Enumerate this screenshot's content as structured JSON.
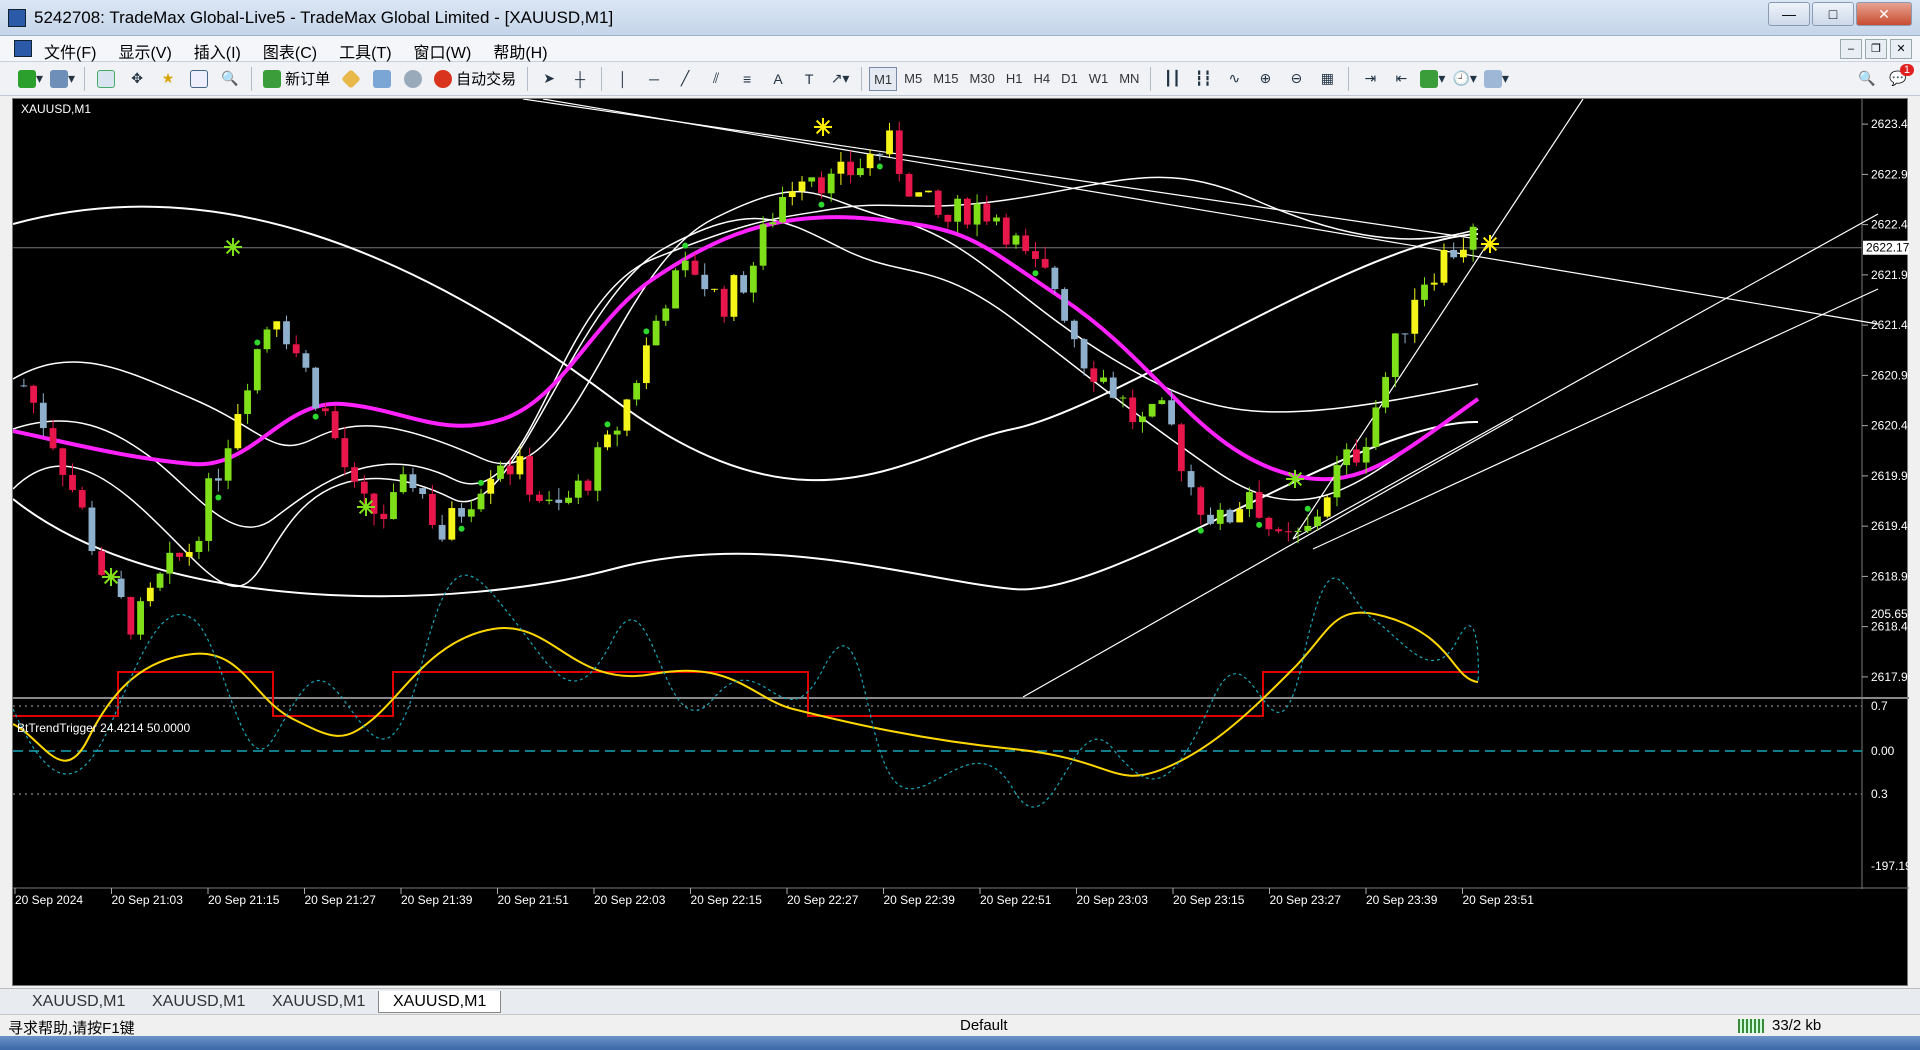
{
  "window": {
    "title": "5242708: TradeMax Global-Live5 - TradeMax Global Limited - [XAUUSD,M1]",
    "min": "—",
    "max": "□",
    "close": "✕"
  },
  "menu": [
    "文件(F)",
    "显示(V)",
    "插入(I)",
    "图表(C)",
    "工具(T)",
    "窗口(W)",
    "帮助(H)"
  ],
  "toolbar": {
    "new_order": "新订单",
    "auto_trading": "自动交易",
    "timeframes": [
      "M1",
      "M5",
      "M15",
      "M30",
      "H1",
      "H4",
      "D1",
      "W1",
      "MN"
    ],
    "active_timeframe": "M1",
    "notif_count": "1"
  },
  "chart": {
    "symbol_label": "XAUUSD,M1",
    "indicator_label": "BtTrendTrigger 24.4214 50.0000",
    "current_price": "2622.17",
    "price_ticks": [
      "2623.40",
      "2622.90",
      "2622.40",
      "2621.90",
      "2621.40",
      "2620.90",
      "2620.40",
      "2619.90",
      "2619.40",
      "2618.90",
      "2618.40",
      "2617.90"
    ],
    "indicator_ticks": [
      "205.6541",
      "0.7",
      "0.00",
      "0.3",
      "-197.1979"
    ],
    "time_ticks": [
      "20 Sep 2024",
      "20 Sep 21:03",
      "20 Sep 21:15",
      "20 Sep 21:27",
      "20 Sep 21:39",
      "20 Sep 21:51",
      "20 Sep 22:03",
      "20 Sep 22:15",
      "20 Sep 22:27",
      "20 Sep 22:39",
      "20 Sep 22:51",
      "20 Sep 23:03",
      "20 Sep 23:15",
      "20 Sep 23:27",
      "20 Sep 23:39",
      "20 Sep 23:51"
    ],
    "colors": {
      "up": "#7fe01a",
      "down": "#e8174b",
      "up_alt": "#f5f51a",
      "down_alt": "#8fb0cc",
      "ma": "#ff22ff",
      "band": "#ffffff",
      "trigger": "#ffd700",
      "step": "#e00000",
      "dotted": "#19a6b8"
    },
    "price_range": [
      2617.7,
      2623.65
    ]
  },
  "chart_data": {
    "type": "candlestick",
    "symbol": "XAUUSD",
    "timeframe": "M1",
    "ylim": [
      2617.7,
      2623.65
    ],
    "current_price": 2622.17,
    "close_path": [
      2620.8,
      2620.3,
      2619.6,
      2618.8,
      2618.4,
      2618.9,
      2619.2,
      2620.0,
      2620.9,
      2621.6,
      2621.0,
      2620.4,
      2619.6,
      2619.5,
      2619.9,
      2619.3,
      2619.7,
      2620.1,
      2619.9,
      2619.5,
      2619.8,
      2620.2,
      2620.9,
      2621.7,
      2622.0,
      2621.6,
      2621.9,
      2622.6,
      2623.0,
      2622.8,
      2623.0,
      2623.2,
      2622.7,
      2622.4,
      2622.6,
      2622.5,
      2622.0,
      2621.8,
      2621.1,
      2620.8,
      2620.4,
      2620.5,
      2619.7,
      2619.4,
      2619.8,
      2619.2,
      2619.3,
      2619.9,
      2620.2,
      2621.0,
      2621.8,
      2622.1,
      2622.3
    ]
  },
  "tabs": [
    "XAUUSD,M1",
    "XAUUSD,M1",
    "XAUUSD,M1",
    "XAUUSD,M1"
  ],
  "status": {
    "help": "寻求帮助,请按F1键",
    "profile": "Default",
    "traffic": "33/2 kb"
  }
}
